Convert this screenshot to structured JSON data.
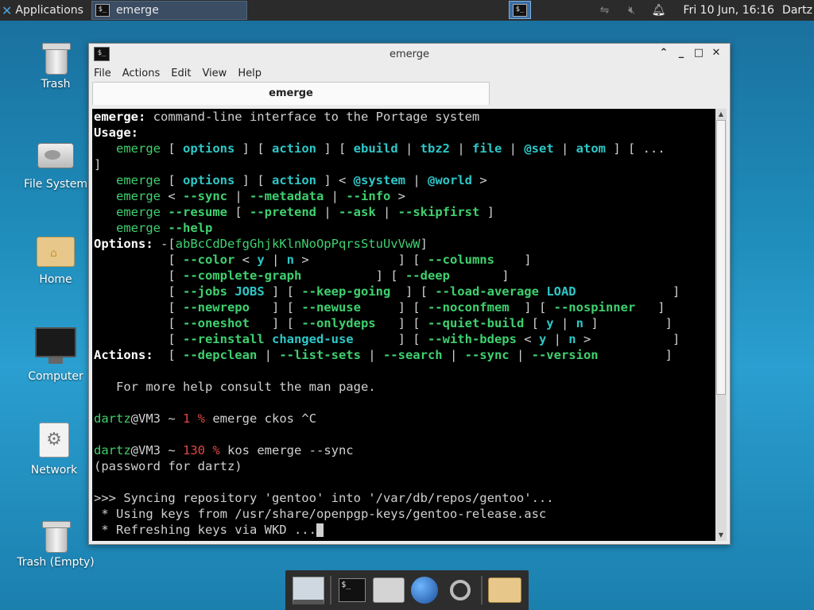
{
  "top_panel": {
    "applications_label": "Applications",
    "task_label": "emerge",
    "clock": "Fri 10 Jun, 16:16",
    "user": "Dartz"
  },
  "desktop": {
    "icons": [
      {
        "label": "Trash"
      },
      {
        "label": "File System"
      },
      {
        "label": "Home"
      },
      {
        "label": "Computer"
      },
      {
        "label": "Network"
      },
      {
        "label": "Trash (Empty)"
      }
    ]
  },
  "window": {
    "title": "emerge",
    "tab_title": "emerge",
    "menu": [
      "File",
      "Actions",
      "Edit",
      "View",
      "Help"
    ]
  },
  "terminal": {
    "line1_a": "emerge:",
    "line1_b": " command-line interface to the Portage system",
    "usage": "Usage:",
    "u1": [
      "emerge",
      "options",
      "action",
      "ebuild",
      "tbz2",
      "file",
      "@set",
      "atom",
      "..."
    ],
    "u2": [
      "emerge",
      "options",
      "action",
      "@system",
      "@world"
    ],
    "u3": [
      "emerge",
      "--sync",
      "--metadata",
      "--info"
    ],
    "u4": [
      "emerge",
      "--resume",
      "--pretend",
      "--ask",
      "--skipfirst"
    ],
    "u5": [
      "emerge",
      "--help"
    ],
    "options_label": "Options:",
    "options_flags": "abBcCdDefgGhjkKlnNoOpPqrsStuUvVwW",
    "opt_rows": [
      [
        "--color",
        "y",
        "n",
        "--columns"
      ],
      [
        "--complete-graph",
        "--deep"
      ],
      [
        "--jobs",
        "JOBS",
        "--keep-going",
        "--load-average",
        "LOAD"
      ],
      [
        "--newrepo",
        "--newuse",
        "--noconfmem",
        "--nospinner"
      ],
      [
        "--oneshot",
        "--onlydeps",
        "--quiet-build",
        "y",
        "n"
      ],
      [
        "--reinstall",
        "changed-use",
        "--with-bdeps",
        "y",
        "n"
      ]
    ],
    "actions_label": "Actions:",
    "actions": [
      "--depclean",
      "--list-sets",
      "--search",
      "--sync",
      "--version"
    ],
    "help_hint": "   For more help consult the man page.",
    "prompt_user": "dartz",
    "prompt_host": "@VM3 ~ ",
    "cmd1_status": "1 %",
    "cmd1": " emerge ckos ^C",
    "cmd2_status": "130 %",
    "cmd2": " kos emerge --sync",
    "password_line": "(password for dartz)",
    "sync_line": ">>> Syncing repository 'gentoo' into '/var/db/repos/gentoo'...",
    "keys_line": " * Using keys from /usr/share/openpgp-keys/gentoo-release.asc",
    "refresh_line": " * Refreshing keys via WKD ..."
  },
  "colors": {
    "terminal_bg": "#000000",
    "green": "#3fd06f",
    "teal": "#2ec7c7",
    "red": "#e04646",
    "panel_bg": "#2b2b2b"
  }
}
